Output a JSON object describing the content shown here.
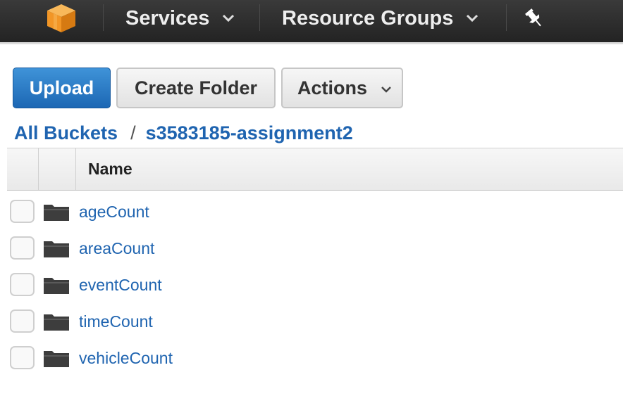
{
  "topbar": {
    "logo_icon": "aws-cube-icon",
    "services_label": "Services",
    "resource_groups_label": "Resource Groups",
    "pin_icon": "pushpin-icon"
  },
  "toolbar": {
    "upload_label": "Upload",
    "create_folder_label": "Create Folder",
    "actions_label": "Actions"
  },
  "breadcrumb": {
    "root_label": "All Buckets",
    "separator": "/",
    "bucket_label": "s3583185-assignment2"
  },
  "table": {
    "columns": [
      "Name"
    ],
    "rows": [
      {
        "name": "ageCount",
        "icon": "folder-icon"
      },
      {
        "name": "areaCount",
        "icon": "folder-icon"
      },
      {
        "name": "eventCount",
        "icon": "folder-icon"
      },
      {
        "name": "timeCount",
        "icon": "folder-icon"
      },
      {
        "name": "vehicleCount",
        "icon": "folder-icon"
      }
    ]
  },
  "colors": {
    "accent": "#1f64b0",
    "primary_button": "#2a7bc8",
    "topbar": "#2b2b2b",
    "logo": "#f29626"
  }
}
